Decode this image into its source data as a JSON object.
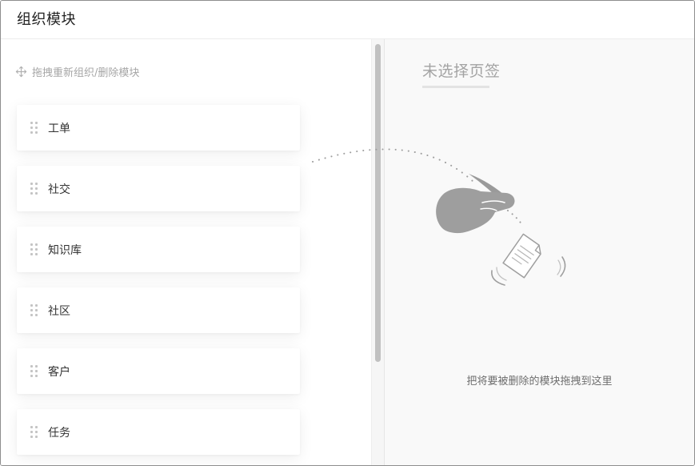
{
  "header": {
    "title": "组织模块"
  },
  "left": {
    "hint_text": "拖拽重新组织/删除模块",
    "hint_icon": "move-icon",
    "grip_icon": "drag-handle-icon",
    "modules": [
      {
        "label": "工单"
      },
      {
        "label": "社交"
      },
      {
        "label": "知识库"
      },
      {
        "label": "社区"
      },
      {
        "label": "客户"
      },
      {
        "label": "任务"
      }
    ]
  },
  "right": {
    "tab_title": "未选择页签",
    "drop_hint": "把将要被删除的模块拖拽到这里",
    "illustration_icons": [
      "hand-drag-icon",
      "document-icon"
    ]
  },
  "colors": {
    "muted_text": "#a6a6a6",
    "card_bg": "#ffffff",
    "right_bg": "#f9f9f9",
    "illustration": "#9e9e9e"
  }
}
